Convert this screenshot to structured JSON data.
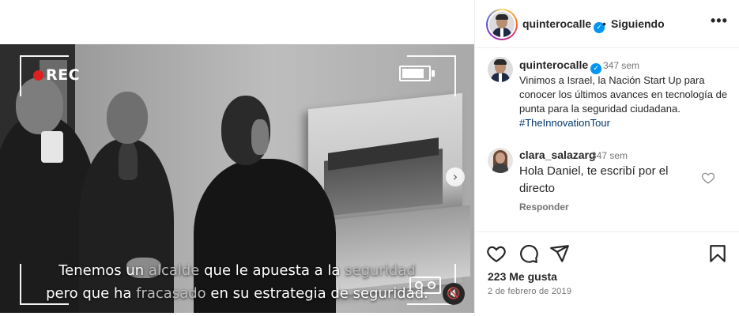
{
  "video": {
    "rec_label": "REC",
    "battery_level": 0.85,
    "subtitle_line1": [
      "Tenemos un ",
      "alcalde",
      " que le apuesta a la ",
      "seguridad"
    ],
    "subtitle_line2": [
      "pero que ha ",
      "fracasado",
      " en su estrategia de seguridad."
    ],
    "next_glyph": "›",
    "mute_glyph": "🔇"
  },
  "header": {
    "username": "quinterocalle",
    "verified_glyph": "✓",
    "dot": "•",
    "follow_label": "Siguiendo",
    "more_glyph": "•••"
  },
  "caption": {
    "username": "quinterocalle",
    "time": "347 sem",
    "text": "Vinimos a Israel, la Nación Start Up para conocer los últimos avances en tecnología de punta para la seguridad ciudadana. ",
    "hashtag": "#TheInnovationTour"
  },
  "comment": {
    "username": "clara_salazarg",
    "time": "347 sem",
    "text": "Hola Daniel, te escribí por el directo",
    "reply_label": "Responder"
  },
  "actions": {
    "likes_text": "223 Me gusta",
    "date_text": "2 de febrero de 2019"
  },
  "icons": {
    "like": "heart-icon",
    "comment": "comment-icon",
    "share": "share-icon",
    "save": "bookmark-icon"
  },
  "colors": {
    "verified": "#0095f6",
    "hashtag": "#00376b",
    "rec_dot": "#e02020",
    "secondary_text": "#737373"
  }
}
